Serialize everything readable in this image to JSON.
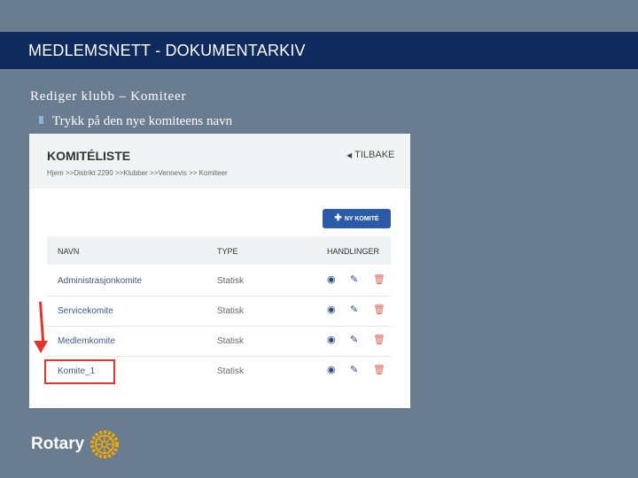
{
  "banner": {
    "title": "MEDLEMSNETT - DOKUMENTARKIV"
  },
  "slide": {
    "heading": "Rediger klubb – Komiteer",
    "bullet": "Trykk på den nye komiteens navn"
  },
  "screenshot": {
    "title": "KOMITÉLISTE",
    "back_label": "TILBAKE",
    "breadcrumb": "Hjem >>Distrikt 2290 >>Klubber >>Vennevis >> Komiteer",
    "new_button": "NY KOMITÉ",
    "columns": {
      "name": "NAVN",
      "type": "TYPE",
      "actions": "HANDLINGER"
    },
    "rows": [
      {
        "name": "Administrasjonkomite",
        "type": "Statisk"
      },
      {
        "name": "Servicekomite",
        "type": "Statisk"
      },
      {
        "name": "Medlemkomite",
        "type": "Statisk"
      },
      {
        "name": "Komite_1",
        "type": "Statisk"
      }
    ]
  },
  "logo": {
    "text": "Rotary"
  },
  "colors": {
    "banner": "#0f2a5e",
    "background": "#6a7d90",
    "accent_red": "#e5332a",
    "button_blue": "#2b5aa8"
  }
}
